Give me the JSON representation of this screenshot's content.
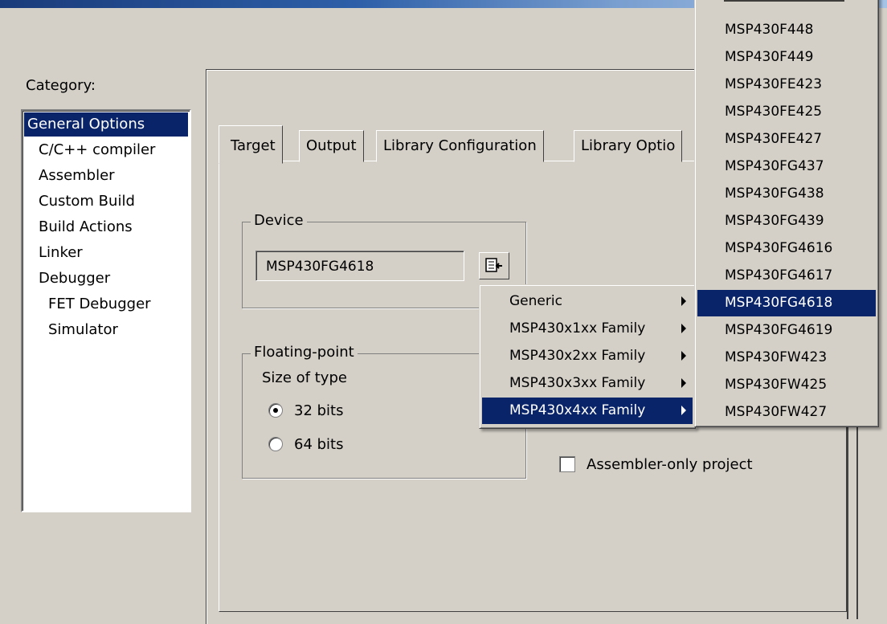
{
  "category": {
    "label": "Category:",
    "items": [
      {
        "label": "General Options",
        "indent": 0,
        "selected": true
      },
      {
        "label": "C/C++ compiler",
        "indent": 1
      },
      {
        "label": "Assembler",
        "indent": 1
      },
      {
        "label": "Custom Build",
        "indent": 1
      },
      {
        "label": "Build Actions",
        "indent": 1
      },
      {
        "label": "Linker",
        "indent": 1
      },
      {
        "label": "Debugger",
        "indent": 1
      },
      {
        "label": "FET Debugger",
        "indent": 2
      },
      {
        "label": "Simulator",
        "indent": 2
      }
    ]
  },
  "tabs": [
    {
      "label": "Target",
      "active": true
    },
    {
      "label": "Output"
    },
    {
      "label": "Library Configuration"
    },
    {
      "label": "Library Optio"
    }
  ],
  "device": {
    "legend": "Device",
    "value": "MSP430FG4618",
    "button_icon": "device-select-icon"
  },
  "floating_point": {
    "legend": "Floating-point",
    "size_label": "Size of type",
    "options": [
      {
        "label": "32 bits",
        "checked": true
      },
      {
        "label": "64 bits",
        "checked": false
      }
    ]
  },
  "assembler_only": {
    "label": "Assembler-only project",
    "checked": false
  },
  "family_menu": {
    "items": [
      {
        "label": "Generic"
      },
      {
        "label": "MSP430x1xx Family"
      },
      {
        "label": "MSP430x2xx Family"
      },
      {
        "label": "MSP430x3xx Family"
      },
      {
        "label": "MSP430x4xx Family",
        "selected": true
      }
    ]
  },
  "device_menu": {
    "items": [
      {
        "label": "MSP430F448"
      },
      {
        "label": "MSP430F449"
      },
      {
        "label": "MSP430FE423"
      },
      {
        "label": "MSP430FE425"
      },
      {
        "label": "MSP430FE427"
      },
      {
        "label": "MSP430FG437"
      },
      {
        "label": "MSP430FG438"
      },
      {
        "label": "MSP430FG439"
      },
      {
        "label": "MSP430FG4616"
      },
      {
        "label": "MSP430FG4617"
      },
      {
        "label": "MSP430FG4618",
        "selected": true
      },
      {
        "label": "MSP430FG4619"
      },
      {
        "label": "MSP430FW423"
      },
      {
        "label": "MSP430FW425"
      },
      {
        "label": "MSP430FW427"
      }
    ]
  },
  "colors": {
    "selection": "#0a246a",
    "face": "#d4d0c8"
  }
}
